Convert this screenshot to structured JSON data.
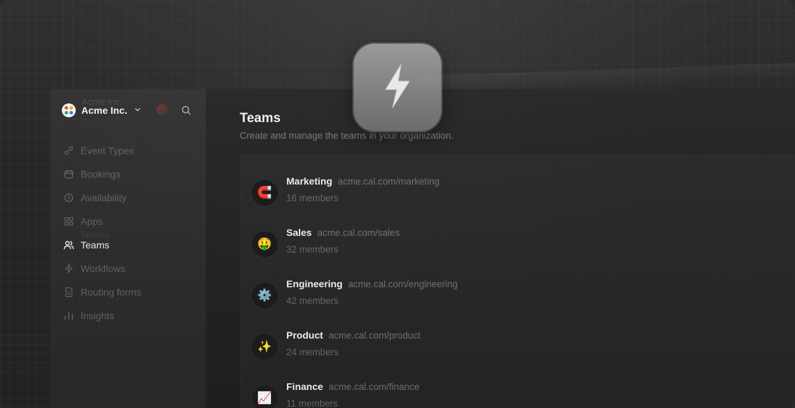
{
  "org": {
    "name": "Acme Inc.",
    "ghost_name": "Acme Inc."
  },
  "nav": [
    {
      "label": "Event Types",
      "icon": "link-icon",
      "active": false
    },
    {
      "label": "Bookings",
      "icon": "calendar-icon",
      "active": false
    },
    {
      "label": "Availability",
      "icon": "clock-icon",
      "active": false
    },
    {
      "label": "Apps",
      "icon": "grid-icon",
      "active": false
    },
    {
      "label": "Teams",
      "icon": "users-icon",
      "active": true
    },
    {
      "label": "Workflows",
      "icon": "zap-icon",
      "active": false
    },
    {
      "label": "Routing forms",
      "icon": "file-icon",
      "active": false
    },
    {
      "label": "Insights",
      "icon": "bar-chart-icon",
      "active": false
    }
  ],
  "ghost_nav_label": "Teams",
  "page": {
    "title": "Teams",
    "subtitle": "Create and manage the teams in your organization."
  },
  "teams": [
    {
      "name": "Marketing",
      "url": "acme.cal.com/marketing",
      "members": "16 members",
      "emoji": "🧲"
    },
    {
      "name": "Sales",
      "url": "acme.cal.com/sales",
      "members": "32 members",
      "emoji": "🤑"
    },
    {
      "name": "Engineering",
      "url": "acme.cal.com/engineering",
      "members": "42 members",
      "emoji": "⚙️"
    },
    {
      "name": "Product",
      "url": "acme.cal.com/product",
      "members": "24 members",
      "emoji": "✨"
    },
    {
      "name": "Finance",
      "url": "acme.cal.com/finance",
      "members": "11 members",
      "emoji": "📈"
    }
  ],
  "colors": {
    "accent": "#ececec",
    "background": "#262626",
    "bolt_tile": "#8f8f8f"
  }
}
